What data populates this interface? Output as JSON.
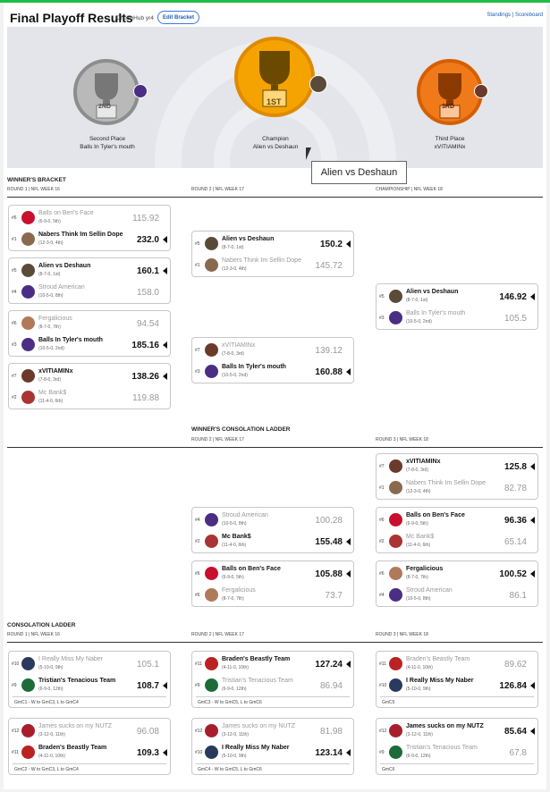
{
  "header": {
    "title": "Final Playoff Results",
    "subtitle": "ChubbHub yr4",
    "edit_label": "Edit Bracket",
    "standings_label": "Standings",
    "sep": " | ",
    "scoreboard_label": "Scoreboard"
  },
  "podium": {
    "second": {
      "rank": "2ND",
      "place": "Second Place",
      "team": "Balls In Tyler's mouth"
    },
    "champion": {
      "rank": "1ST",
      "place": "Champion",
      "team": "Alien vs Deshaun"
    },
    "third": {
      "rank": "3RD",
      "place": "Third Place",
      "team": "xVITIAMINx"
    }
  },
  "tooltip": "Alien vs Deshaun",
  "sections": {
    "winners": {
      "title": "WINNER'S BRACKET",
      "r1": "ROUND 1 | NFL WEEK 16",
      "r2": "ROUND 2 | NFL WEEK 17",
      "r3": "CHAMPIONSHIP | NFL WEEK 18"
    },
    "wcons": {
      "title": "WINNER'S CONSOLATION LADDER",
      "r2": "ROUND 2 | NFL WEEK 17",
      "r3": "ROUND 3 | NFL WEEK 18"
    },
    "cons": {
      "title": "CONSOLATION LADDER",
      "r1": "ROUND 1 | NFL WEEK 16",
      "r2": "ROUND 2 | NFL WEEK 17",
      "r3": "ROUND 3 | NFL WEEK 18"
    }
  },
  "games": [
    {
      "id": "w1",
      "teams": [
        {
          "seed": "#6",
          "name": "Balls on Ben's Face",
          "rec": "(6-9-0, 5th)",
          "score": "115.92",
          "win": false,
          "color": "#c8102e"
        },
        {
          "seed": "#1",
          "name": "Nabers Think Im Sellin Dope",
          "rec": "(12-3-0, 4th)",
          "score": "232.0",
          "win": true,
          "color": "#8a6a4e"
        }
      ]
    },
    {
      "id": "w2",
      "teams": [
        {
          "seed": "#5",
          "name": "Alien vs Deshaun",
          "rec": "(8-7-0, 1st)",
          "score": "160.1",
          "win": true,
          "color": "#5a4a3a"
        },
        {
          "seed": "#4",
          "name": "Stroud American",
          "rec": "(10-5-0, 8th)",
          "score": "158.0",
          "win": false,
          "color": "#4b2e83"
        }
      ]
    },
    {
      "id": "w3",
      "teams": [
        {
          "seed": "#6",
          "name": "Fergalicious",
          "rec": "(8-7-0, 7th)",
          "score": "94.54",
          "win": false,
          "color": "#b07a5a"
        },
        {
          "seed": "#3",
          "name": "Balls In Tyler's mouth",
          "rec": "(10-5-0, 2nd)",
          "score": "185.16",
          "win": true,
          "color": "#4b2e83"
        }
      ]
    },
    {
      "id": "w4",
      "teams": [
        {
          "seed": "#7",
          "name": "xVITIAMINx",
          "rec": "(7-8-0, 3rd)",
          "score": "138.26",
          "win": true,
          "color": "#6b3a2a"
        },
        {
          "seed": "#2",
          "name": "Mc Bank$",
          "rec": "(11-4-0, 6th)",
          "score": "119.88",
          "win": false,
          "color": "#a33"
        }
      ]
    },
    {
      "id": "w5",
      "teams": [
        {
          "seed": "#5",
          "name": "Alien vs Deshaun",
          "rec": "(8-7-0, 1st)",
          "score": "150.2",
          "win": true,
          "color": "#5a4a3a"
        },
        {
          "seed": "#1",
          "name": "Nabers Think Im Sellin Dope",
          "rec": "(12-3-0, 4th)",
          "score": "145.72",
          "win": false,
          "color": "#8a6a4e"
        }
      ]
    },
    {
      "id": "w6",
      "teams": [
        {
          "seed": "#7",
          "name": "xVITIAMINx",
          "rec": "(7-8-0, 3rd)",
          "score": "139.12",
          "win": false,
          "color": "#6b3a2a"
        },
        {
          "seed": "#3",
          "name": "Balls In Tyler's mouth",
          "rec": "(10-5-0, 2nd)",
          "score": "160.88",
          "win": true,
          "color": "#4b2e83"
        }
      ]
    },
    {
      "id": "w7",
      "teams": [
        {
          "seed": "#5",
          "name": "Alien vs Deshaun",
          "rec": "(8-7-0, 1st)",
          "score": "146.92",
          "win": true,
          "color": "#5a4a3a"
        },
        {
          "seed": "#3",
          "name": "Balls In Tyler's mouth",
          "rec": "(10-5-0, 2nd)",
          "score": "105.5",
          "win": false,
          "color": "#4b2e83"
        }
      ]
    },
    {
      "id": "c1",
      "teams": [
        {
          "seed": "#4",
          "name": "Stroud American",
          "rec": "(10-5-0, 8th)",
          "score": "100.28",
          "win": false,
          "color": "#4b2e83"
        },
        {
          "seed": "#2",
          "name": "Mc Bank$",
          "rec": "(11-4-0, 6th)",
          "score": "155.48",
          "win": true,
          "color": "#a33"
        }
      ]
    },
    {
      "id": "c2",
      "teams": [
        {
          "seed": "#6",
          "name": "Balls on Ben's Face",
          "rec": "(6-9-0, 5th)",
          "score": "105.88",
          "win": true,
          "color": "#c8102e"
        },
        {
          "seed": "#6",
          "name": "Fergalicious",
          "rec": "(8-7-0, 7th)",
          "score": "73.7",
          "win": false,
          "color": "#b07a5a"
        }
      ]
    },
    {
      "id": "c3",
      "teams": [
        {
          "seed": "#7",
          "name": "xVITIAMINx",
          "rec": "(7-8-0, 3rd)",
          "score": "125.8",
          "win": true,
          "color": "#6b3a2a"
        },
        {
          "seed": "#1",
          "name": "Nabers Think Im Sellin Dope",
          "rec": "(12-3-0, 4th)",
          "score": "82.78",
          "win": false,
          "color": "#8a6a4e"
        }
      ]
    },
    {
      "id": "c4",
      "teams": [
        {
          "seed": "#6",
          "name": "Balls on Ben's Face",
          "rec": "(6-9-0, 5th)",
          "score": "96.36",
          "win": true,
          "color": "#c8102e"
        },
        {
          "seed": "#2",
          "name": "Mc Bank$",
          "rec": "(11-4-0, 6th)",
          "score": "65.14",
          "win": false,
          "color": "#a33"
        }
      ]
    },
    {
      "id": "c5",
      "teams": [
        {
          "seed": "#6",
          "name": "Fergalicious",
          "rec": "(8-7-0, 7th)",
          "score": "100.52",
          "win": true,
          "color": "#b07a5a"
        },
        {
          "seed": "#4",
          "name": "Stroud American",
          "rec": "(10-5-0, 8th)",
          "score": "86.1",
          "win": false,
          "color": "#4b2e83"
        }
      ]
    },
    {
      "id": "l1",
      "foot": "GmC1 - W to GmC3, L to GmC4",
      "teams": [
        {
          "seed": "#10",
          "name": "I Really Miss My Naber",
          "rec": "(5-10-0, 9th)",
          "score": "105.1",
          "win": false,
          "color": "#2a3a5e"
        },
        {
          "seed": "#9",
          "name": "Tristian's Tenacious Team",
          "rec": "(6-9-0, 12th)",
          "score": "108.7",
          "win": true,
          "color": "#1e6b3a"
        }
      ]
    },
    {
      "id": "l2",
      "foot": "GmC2 - W to GmC3, L to GmC4",
      "teams": [
        {
          "seed": "#12",
          "name": "James sucks on my NUTZ",
          "rec": "(3-12-0, 11th)",
          "score": "96.08",
          "win": false,
          "color": "#a81d2c"
        },
        {
          "seed": "#11",
          "name": "Braden's Beastly Team",
          "rec": "(4-11-0, 10th)",
          "score": "109.3",
          "win": true,
          "color": "#b22"
        }
      ]
    },
    {
      "id": "l3",
      "foot": "GmC3 - W to GmC5, L to GmC6",
      "teams": [
        {
          "seed": "#11",
          "name": "Braden's Beastly Team",
          "rec": "(4-11-0, 10th)",
          "score": "127.24",
          "win": true,
          "color": "#b22"
        },
        {
          "seed": "#9",
          "name": "Tristian's Tenacious Team",
          "rec": "(6-9-0, 12th)",
          "score": "86.94",
          "win": false,
          "color": "#1e6b3a"
        }
      ]
    },
    {
      "id": "l4",
      "foot": "GmC4 - W to GmC5, L to GmC6",
      "teams": [
        {
          "seed": "#12",
          "name": "James sucks on my NUTZ",
          "rec": "(3-12-0, 11th)",
          "score": "81.98",
          "win": false,
          "color": "#a81d2c"
        },
        {
          "seed": "#10",
          "name": "I Really Miss My Naber",
          "rec": "(5-10-0, 9th)",
          "score": "123.14",
          "win": true,
          "color": "#2a3a5e"
        }
      ]
    },
    {
      "id": "l5",
      "foot": "GmC5",
      "teams": [
        {
          "seed": "#11",
          "name": "Braden's Beastly Team",
          "rec": "(4-11-0, 10th)",
          "score": "89.62",
          "win": false,
          "color": "#b22"
        },
        {
          "seed": "#10",
          "name": "I Really Miss My Naber",
          "rec": "(5-10-0, 9th)",
          "score": "126.84",
          "win": true,
          "color": "#2a3a5e"
        }
      ]
    },
    {
      "id": "l6",
      "foot": "GmC6",
      "teams": [
        {
          "seed": "#12",
          "name": "James sucks on my NUTZ",
          "rec": "(3-12-0, 11th)",
          "score": "85.64",
          "win": true,
          "color": "#a81d2c"
        },
        {
          "seed": "#9",
          "name": "Tristian's Tenacious Team",
          "rec": "(6-9-0, 12th)",
          "score": "67.8",
          "win": false,
          "color": "#1e6b3a"
        }
      ]
    }
  ]
}
